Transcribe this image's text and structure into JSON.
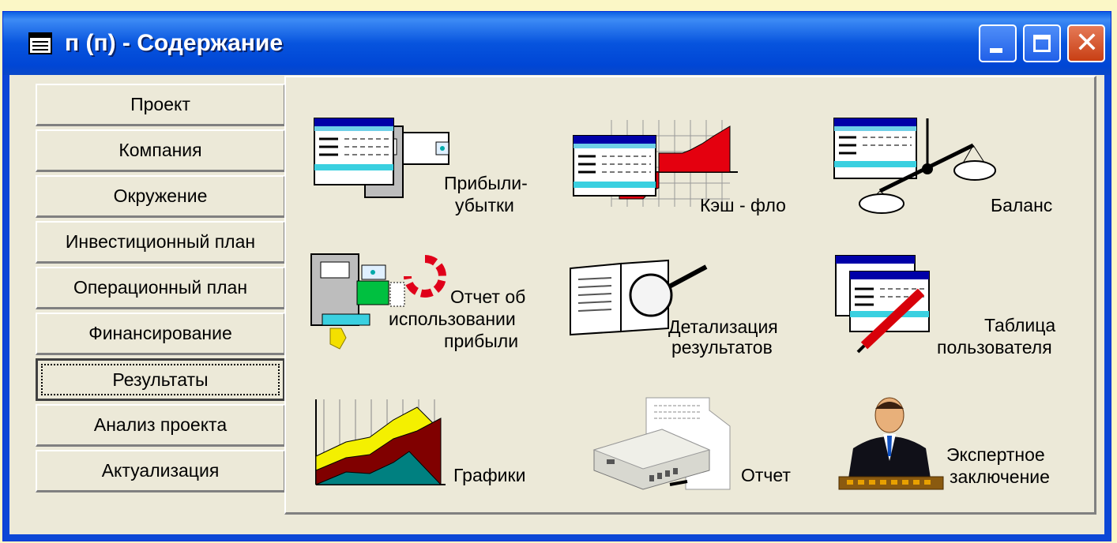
{
  "window": {
    "title": "п (п) - Содержание",
    "icon": "document-icon",
    "controls": [
      "minimize-icon",
      "maximize-icon",
      "close-icon"
    ]
  },
  "nav": {
    "items": [
      {
        "label": "Проект"
      },
      {
        "label": "Компания"
      },
      {
        "label": "Окружение"
      },
      {
        "label": "Инвестиционный план"
      },
      {
        "label": "Операционный план"
      },
      {
        "label": "Финансирование"
      },
      {
        "label": "Результаты",
        "selected": true
      },
      {
        "label": "Анализ проекта"
      },
      {
        "label": "Актуализация"
      }
    ]
  },
  "tiles": [
    {
      "line1": "Прибыли-",
      "line2": "убытки",
      "icon": "profit-loss-icon"
    },
    {
      "line1": "Кэш - фло",
      "icon": "cash-flow-icon"
    },
    {
      "line1": "Баланс",
      "icon": "balance-scale-icon"
    },
    {
      "line1": "Отчет об",
      "line2": "использовании",
      "line3": "прибыли",
      "icon": "profit-use-icon"
    },
    {
      "line1": "Детализация",
      "line2": "результатов",
      "icon": "magnifier-book-icon"
    },
    {
      "line1": "Таблица",
      "line2": "пользователя",
      "icon": "user-table-icon"
    },
    {
      "line1": "Графики",
      "icon": "area-chart-icon"
    },
    {
      "line1": "Отчет",
      "icon": "printer-icon"
    },
    {
      "line1": "Экспертное",
      "line2": "заключение",
      "icon": "expert-icon"
    }
  ],
  "colors": {
    "background": "#fbf7c6",
    "titlebar": "#0754de",
    "window": "#ece9d8",
    "close_button": "#c83f14"
  }
}
